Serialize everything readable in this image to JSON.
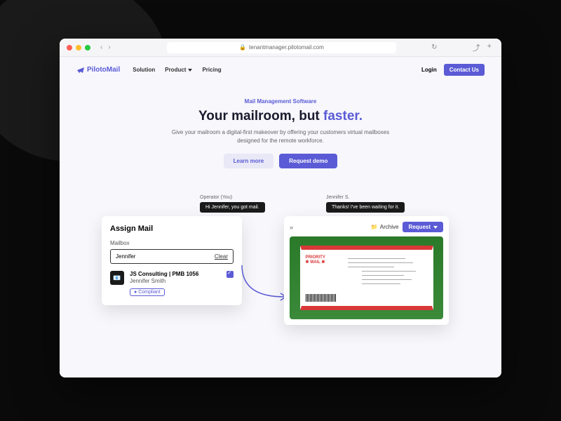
{
  "browser": {
    "url": "tenantmanager.pilotomail.com"
  },
  "nav": {
    "brand": "PilotoMail",
    "links": {
      "solution": "Solution",
      "product": "Product",
      "pricing": "Pricing"
    },
    "login": "Login",
    "contact": "Contact Us"
  },
  "hero": {
    "eyebrow": "Mail Management Software",
    "title_a": "Your mailroom, but ",
    "title_b": "faster.",
    "subtitle": "Give your mailroom a digital-first makeover by offering your customers virtual mailboxes designed for the remote workforce.",
    "learn_more": "Learn more",
    "request_demo": "Request demo"
  },
  "assign": {
    "title": "Assign Mail",
    "label": "Mailbox",
    "value": "Jennifer",
    "clear": "Clear",
    "result": {
      "company": "JS Consulting",
      "pmb": "PMB 1056",
      "name": "Jennifer Smith",
      "badge": "Compliant"
    }
  },
  "tooltips": {
    "operator_label": "Operator (You)",
    "operator_msg": "Hi Jennifer, you got mail.",
    "jennifer_label": "Jennifer S.",
    "jennifer_msg": "Thanks! I've been waiting for it."
  },
  "preview": {
    "archive": "Archive",
    "request": "Request",
    "priority": "PRIORITY",
    "mail": "MAIL"
  }
}
